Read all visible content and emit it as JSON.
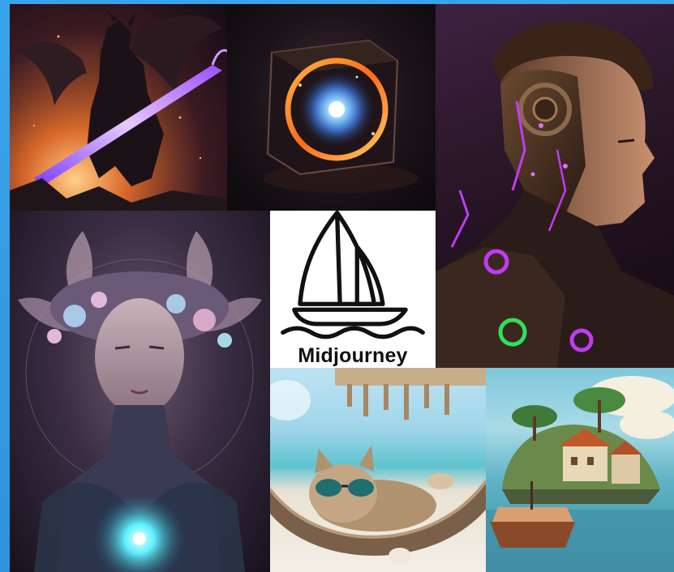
{
  "brand": {
    "name": "Midjourney",
    "logo_icon": "sailboat-icon"
  },
  "collage": {
    "tiles": [
      {
        "id": "dragon",
        "subject": "dragon-warrior-artwork"
      },
      {
        "id": "cube",
        "subject": "glowing-cube-artwork"
      },
      {
        "id": "cyborg",
        "subject": "cyborg-portrait-artwork"
      },
      {
        "id": "woman",
        "subject": "floral-woman-portrait-artwork"
      },
      {
        "id": "logo",
        "subject": "midjourney-logo"
      },
      {
        "id": "cat",
        "subject": "cat-in-hammock-photo"
      },
      {
        "id": "island",
        "subject": "island-village-artwork"
      }
    ]
  },
  "colors": {
    "frame": "#3aa4ea",
    "logo_bg": "#ffffff",
    "logo_ink": "#111111",
    "neon_purple": "#c03cf0",
    "neon_green": "#2fe05a",
    "glow_cyan": "#5ff0ff"
  }
}
